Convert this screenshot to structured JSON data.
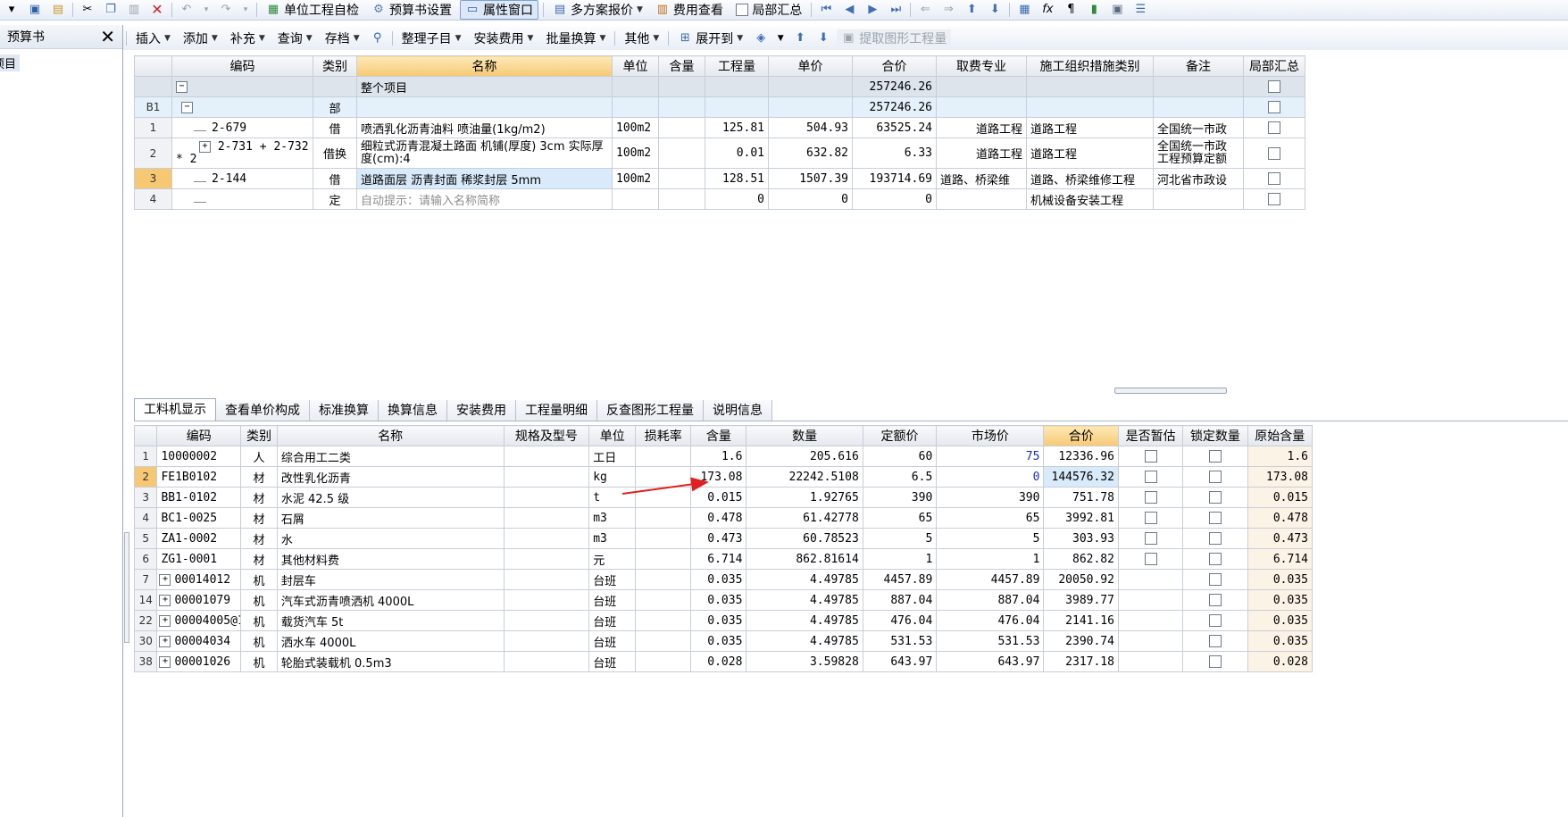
{
  "toolbar": {
    "items": [
      {
        "icon": "unit-check-icon",
        "label": "单位工程自检"
      },
      {
        "icon": "budget-settings-icon",
        "label": "预算书设置"
      },
      {
        "icon": "property-window-icon",
        "label": "属性窗口",
        "active": true
      },
      {
        "icon": "multi-quote-icon",
        "label": "多方案报价",
        "dropdown": true
      },
      {
        "icon": "cost-view-icon",
        "label": "费用查看"
      },
      {
        "icon": "checkbox",
        "label": "局部汇总"
      }
    ]
  },
  "toolbar2": {
    "items": [
      {
        "label": "插入",
        "dropdown": true
      },
      {
        "label": "添加",
        "dropdown": true
      },
      {
        "label": "补充",
        "dropdown": true
      },
      {
        "label": "查询",
        "dropdown": true
      },
      {
        "label": "存档",
        "dropdown": true
      },
      {
        "label": "整理子目",
        "dropdown": true
      },
      {
        "label": "安装费用",
        "dropdown": true
      },
      {
        "label": "批量换算",
        "dropdown": true
      },
      {
        "label": "其他",
        "dropdown": true
      },
      {
        "label": "展开到",
        "dropdown": true
      },
      {
        "label": "提取图形工程量",
        "disabled": true
      }
    ]
  },
  "left_panel": {
    "title": "预算书",
    "item": "项目"
  },
  "upper_table": {
    "headers": [
      "编码",
      "类别",
      "名称",
      "单位",
      "含量",
      "工程量",
      "单价",
      "合价",
      "取费专业",
      "施工组织措施类别",
      "备注",
      "局部汇总"
    ],
    "top_row": {
      "name": "整个项目",
      "total": "257246.26"
    },
    "b1_row": {
      "rn": "B1",
      "type": "部",
      "total": "257246.26"
    },
    "rows": [
      {
        "rn": "1",
        "code": "2-679",
        "type": "借",
        "name": "喷洒乳化沥青油料 喷油量(1kg/m2)",
        "unit": "100m2",
        "qty": "125.81",
        "price": "504.93",
        "total": "63525.24",
        "fee": "道路工程",
        "measure": "道路工程",
        "remark": "全国统一市政"
      },
      {
        "rn": "2",
        "code": "2-731 + 2-732 * 2",
        "type": "借换",
        "name": "细粒式沥青混凝土路面 机铺(厚度) 3cm 实际厚度(cm):4",
        "unit": "100m2",
        "qty": "0.01",
        "price": "632.82",
        "total": "6.33",
        "fee": "道路工程",
        "measure": "道路工程",
        "remark": "全国统一市政 工程预算定额"
      },
      {
        "rn": "3",
        "code": "2-144",
        "type": "借",
        "name": "道路面层 沥青封面 稀浆封层 5mm",
        "unit": "100m2",
        "qty": "128.51",
        "price": "1507.39",
        "total": "193714.69",
        "fee": "道路、桥梁维",
        "measure": "道路、桥梁维修工程",
        "remark": "河北省市政设"
      },
      {
        "rn": "4",
        "code": "",
        "type": "定",
        "name": "自动提示：请输入名称简称",
        "unit": "",
        "qty": "0",
        "price": "0",
        "total": "0",
        "fee": "",
        "measure": "机械设备安装工程",
        "remark": ""
      }
    ]
  },
  "tabs": [
    "工料机显示",
    "查看单价构成",
    "标准换算",
    "换算信息",
    "安装费用",
    "工程量明细",
    "反查图形工程量",
    "说明信息"
  ],
  "lower_table": {
    "headers": [
      "编码",
      "类别",
      "名称",
      "规格及型号",
      "单位",
      "损耗率",
      "含量",
      "数量",
      "定额价",
      "市场价",
      "合价",
      "是否暂估",
      "锁定数量",
      "原始含量"
    ],
    "rows": [
      {
        "rn": "1",
        "code": "10000002",
        "type": "人",
        "name": "综合用工二类",
        "unit": "工日",
        "content": "1.6",
        "qty": "205.616",
        "base": "60",
        "market": "75",
        "total": "12336.96",
        "orig": "1.6"
      },
      {
        "rn": "2",
        "code": "FE1B0102",
        "type": "材",
        "name": "改性乳化沥青",
        "unit": "kg",
        "content": "173.08",
        "qty": "22242.5108",
        "base": "6.5",
        "market": "0",
        "total": "144576.32",
        "orig": "173.08"
      },
      {
        "rn": "3",
        "code": "BB1-0102",
        "type": "材",
        "name": "水泥 42.5 级",
        "unit": "t",
        "content": "0.015",
        "qty": "1.92765",
        "base": "390",
        "market": "390",
        "total": "751.78",
        "orig": "0.015"
      },
      {
        "rn": "4",
        "code": "BC1-0025",
        "type": "材",
        "name": "石屑",
        "unit": "m3",
        "content": "0.478",
        "qty": "61.42778",
        "base": "65",
        "market": "65",
        "total": "3992.81",
        "orig": "0.478"
      },
      {
        "rn": "5",
        "code": "ZA1-0002",
        "type": "材",
        "name": "水",
        "unit": "m3",
        "content": "0.473",
        "qty": "60.78523",
        "base": "5",
        "market": "5",
        "total": "303.93",
        "orig": "0.473"
      },
      {
        "rn": "6",
        "code": "ZG1-0001",
        "type": "材",
        "name": "其他材料费",
        "unit": "元",
        "content": "6.714",
        "qty": "862.81614",
        "base": "1",
        "market": "1",
        "total": "862.82",
        "orig": "6.714"
      },
      {
        "rn": "7",
        "code": "00014012",
        "type": "机",
        "name": "封层车",
        "unit": "台班",
        "content": "0.035",
        "qty": "4.49785",
        "base": "4457.89",
        "market": "4457.89",
        "total": "20050.92",
        "orig": "0.035"
      },
      {
        "rn": "14",
        "code": "00001079",
        "type": "机",
        "name": "汽车式沥青喷洒机 4000L",
        "unit": "台班",
        "content": "0.035",
        "qty": "4.49785",
        "base": "887.04",
        "market": "887.04",
        "total": "3989.77",
        "orig": "0.035"
      },
      {
        "rn": "22",
        "code": "00004005@1",
        "type": "机",
        "name": "载货汽车 5t",
        "unit": "台班",
        "content": "0.035",
        "qty": "4.49785",
        "base": "476.04",
        "market": "476.04",
        "total": "2141.16",
        "orig": "0.035"
      },
      {
        "rn": "30",
        "code": "00004034",
        "type": "机",
        "name": "洒水车 4000L",
        "unit": "台班",
        "content": "0.035",
        "qty": "4.49785",
        "base": "531.53",
        "market": "531.53",
        "total": "2390.74",
        "orig": "0.035"
      },
      {
        "rn": "38",
        "code": "00001026",
        "type": "机",
        "name": "轮胎式装载机 0.5m3",
        "unit": "台班",
        "content": "0.028",
        "qty": "3.59828",
        "base": "643.97",
        "market": "643.97",
        "total": "2317.18",
        "orig": "0.028"
      }
    ]
  },
  "colors": {
    "accent_header": "#f7c873",
    "selected_row": "#d9ebfb",
    "arrow": "#e02020",
    "blue_value": "#1a2dc9"
  }
}
